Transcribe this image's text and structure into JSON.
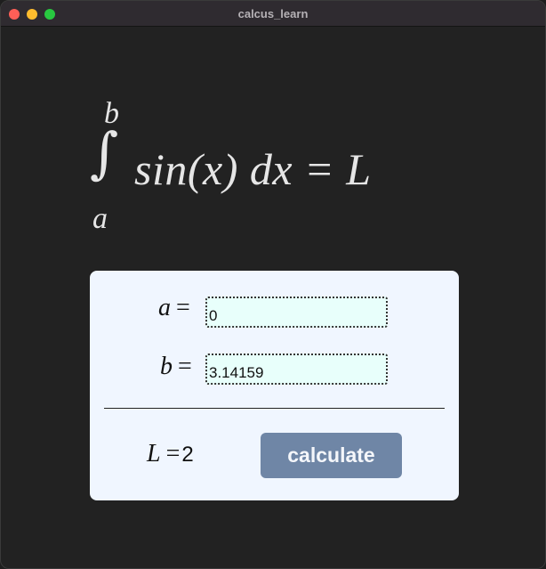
{
  "window": {
    "title": "calcus_learn"
  },
  "formula": {
    "upper_limit": "b",
    "integral_sign": "∫",
    "lower_limit": "a",
    "integrand": "sin(x) dx = L"
  },
  "form": {
    "a_symbol": "a",
    "b_symbol": "b",
    "equals": "=",
    "a_value": "0",
    "b_value": "3.14159"
  },
  "result": {
    "symbol": "L",
    "equals": "=",
    "value": "2"
  },
  "actions": {
    "calculate_label": "calculate"
  },
  "colors": {
    "background": "#222222",
    "card": "#f0f6ff",
    "input_bg": "#e8fffb",
    "button": "#6f86a6",
    "button_text": "#f4f6fa"
  }
}
